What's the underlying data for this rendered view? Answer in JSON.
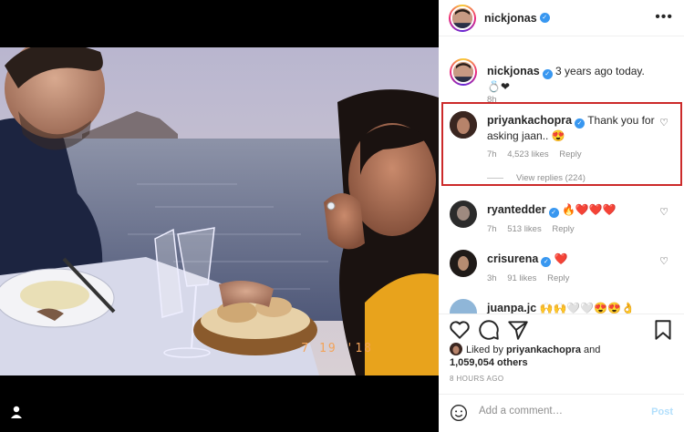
{
  "post": {
    "username": "nickjonas",
    "photo_date_stamp": "7 19 '18"
  },
  "caption": {
    "username": "nickjonas",
    "text": "3 years ago today. 💍❤",
    "time": "8h"
  },
  "comments": [
    {
      "username": "priyankachopra",
      "text": "Thank you for asking jaan.. 😍",
      "time": "7h",
      "likes": "4,523 likes",
      "reply": "Reply",
      "view_replies": "View replies (224)",
      "highlighted": true
    },
    {
      "username": "ryantedder",
      "text": "🔥❤️❤️❤️",
      "time": "7h",
      "likes": "513 likes",
      "reply": "Reply"
    },
    {
      "username": "crisurena",
      "text": "❤️",
      "time": "3h",
      "likes": "91 likes",
      "reply": "Reply"
    },
    {
      "username": "juanpa.jc",
      "text": "🙌🙌🤍🤍😍😍👌",
      "time": "",
      "likes": "",
      "reply": ""
    }
  ],
  "likes_summary": {
    "prefix": "Liked by",
    "user": "priyankachopra",
    "joiner": "and",
    "others": "1,059,054 others"
  },
  "posted_ago": "8 HOURS AGO",
  "add_comment": {
    "placeholder": "Add a comment…",
    "post_label": "Post"
  },
  "colors": {
    "highlight_border": "#cc2a2a",
    "verified": "#3897f0",
    "like_red": "#ed4956",
    "post_disabled": "#b2dffc"
  },
  "icons": [
    "heart-icon",
    "comment-icon",
    "share-icon",
    "bookmark-icon",
    "emoji-icon",
    "more-icon",
    "verified-badge-icon"
  ]
}
